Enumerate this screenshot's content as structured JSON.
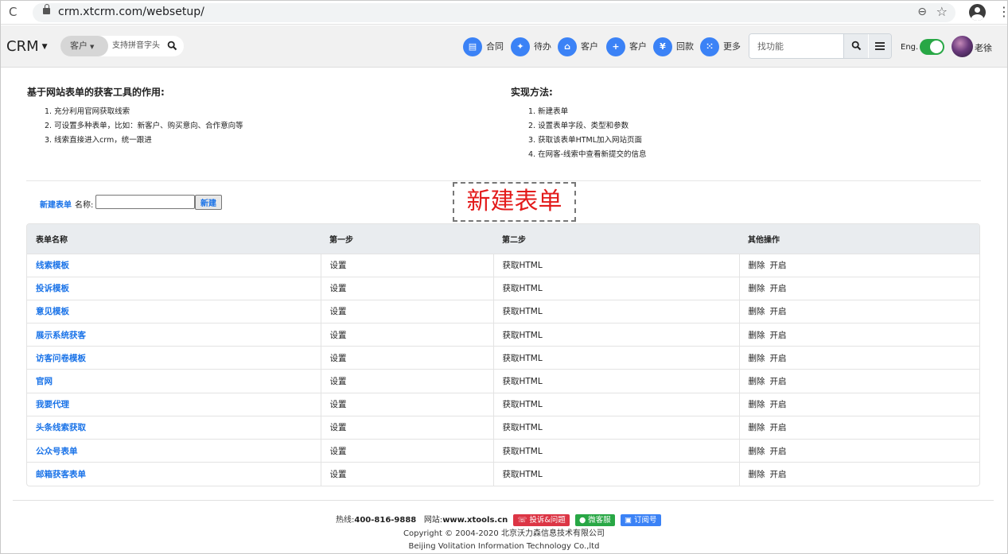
{
  "browser": {
    "url": "crm.xtcrm.com/websetup/",
    "reload_glyph": "C",
    "zoom_glyph": "⊖",
    "star_glyph": "☆",
    "menu_glyph": "⋮"
  },
  "nav": {
    "brand": "CRM",
    "customer_select": "客户",
    "search_placeholder": "支持拼音字头",
    "items": [
      {
        "label": "合同",
        "glyph": "▤",
        "icon": "contract-icon"
      },
      {
        "label": "待办",
        "glyph": "✦",
        "icon": "todo-icon"
      },
      {
        "label": "客户",
        "glyph": "⌂",
        "icon": "bank-icon"
      },
      {
        "label": "客户",
        "glyph": "+",
        "icon": "add-customer-icon"
      },
      {
        "label": "回款",
        "glyph": "¥",
        "icon": "yen-icon"
      },
      {
        "label": "更多",
        "glyph": "⁙",
        "icon": "more-grid-icon"
      }
    ],
    "function_placeholder": "找功能",
    "lang_label": "Eng.",
    "user_name": "老徐"
  },
  "intro": {
    "left_title": "基于网站表单的获客工具的作用:",
    "left_items": [
      "1. 充分利用官网获取线索",
      "2. 可设置多种表单，比如：新客户、购买意向、合作意向等",
      "3. 线索直接进入crm，统一跟进"
    ],
    "right_title": "实现方法:",
    "right_items": [
      "1. 新建表单",
      "2. 设置表单字段、类型和参数",
      "3. 获取该表单HTML加入网站页面",
      "4. 在网客-线索中查看新提交的信息"
    ]
  },
  "form": {
    "new_link": "新建表单",
    "name_label": "名称:",
    "name_value": "",
    "create_button": "新建"
  },
  "annotation": "新建表单",
  "table": {
    "headers": [
      "表单名称",
      "第一步",
      "第二步",
      "其他操作"
    ],
    "rows": [
      {
        "name": "线索模板",
        "step1": "设置",
        "step2": "获取HTML",
        "delete": "删除",
        "enable": "开启"
      },
      {
        "name": "投诉模板",
        "step1": "设置",
        "step2": "获取HTML",
        "delete": "删除",
        "enable": "开启"
      },
      {
        "name": "意见模板",
        "step1": "设置",
        "step2": "获取HTML",
        "delete": "删除",
        "enable": "开启"
      },
      {
        "name": "展示系统获客",
        "step1": "设置",
        "step2": "获取HTML",
        "delete": "删除",
        "enable": "开启"
      },
      {
        "name": "访客问卷模板",
        "step1": "设置",
        "step2": "获取HTML",
        "delete": "删除",
        "enable": "开启"
      },
      {
        "name": "官网",
        "step1": "设置",
        "step2": "获取HTML",
        "delete": "删除",
        "enable": "开启"
      },
      {
        "name": "我要代理",
        "step1": "设置",
        "step2": "获取HTML",
        "delete": "删除",
        "enable": "开启"
      },
      {
        "name": "头条线索获取",
        "step1": "设置",
        "step2": "获取HTML",
        "delete": "删除",
        "enable": "开启"
      },
      {
        "name": "公众号表单",
        "step1": "设置",
        "step2": "获取HTML",
        "delete": "删除",
        "enable": "开启"
      },
      {
        "name": "邮箱获客表单",
        "step1": "设置",
        "step2": "获取HTML",
        "delete": "删除",
        "enable": "开启"
      }
    ]
  },
  "footer": {
    "hotline_label": "热线:",
    "hotline": "400-816-9888",
    "site_label": "网站:",
    "site": "www.xtools.cn",
    "badge_complaint": "投诉&问题",
    "badge_wechat": "微客服",
    "badge_subscribe": "订阅号",
    "copyright": "Copyright © 2004-2020  北京沃力森信息技术有限公司",
    "company_en": "Beijing Volitation Information Technology Co.,ltd"
  },
  "colors": {
    "accent_blue": "#3b82f6",
    "link_blue": "#1a73e8",
    "toggle_green": "#28a745",
    "annotation_red": "#e31b1b"
  }
}
